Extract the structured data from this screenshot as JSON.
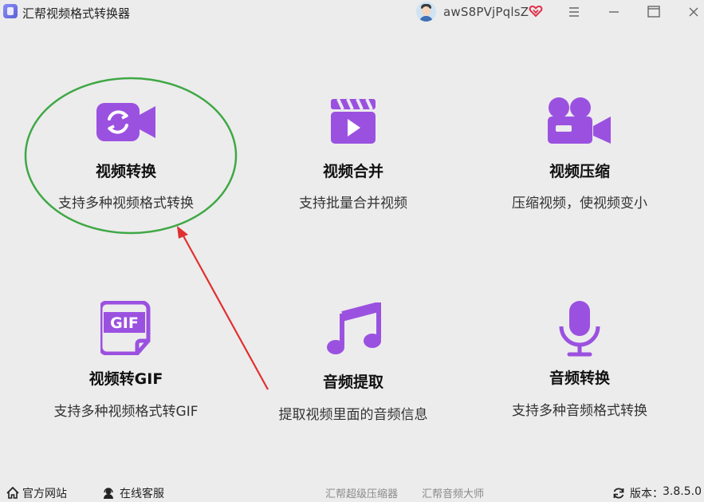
{
  "window": {
    "title": "汇帮视频格式转换器",
    "username": "awS8PVjPqlsZ"
  },
  "colors": {
    "accent": "#9b51e0",
    "annotation_circle": "#3fa845",
    "annotation_arrow": "#e03030"
  },
  "features": [
    {
      "title": "视频转换",
      "desc": "支持多种视频格式转换",
      "icon": "video-convert-icon"
    },
    {
      "title": "视频合并",
      "desc": "支持批量合并视频",
      "icon": "clapperboard-icon"
    },
    {
      "title": "视频压缩",
      "desc": "压缩视频，使视频变小",
      "icon": "video-camera-icon"
    },
    {
      "title": "视频转GIF",
      "desc": "支持多种视频格式转GIF",
      "icon": "gif-file-icon"
    },
    {
      "title": "音频提取",
      "desc": "提取视频里面的音频信息",
      "icon": "music-note-icon"
    },
    {
      "title": "音频转换",
      "desc": "支持多种音频格式转换",
      "icon": "microphone-icon"
    }
  ],
  "footer": {
    "website": "官方网站",
    "support": "在线客服",
    "link1": "汇帮超级压缩器",
    "link2": "汇帮音频大师",
    "version_label": "版本：",
    "version": "3.8.5.0"
  }
}
